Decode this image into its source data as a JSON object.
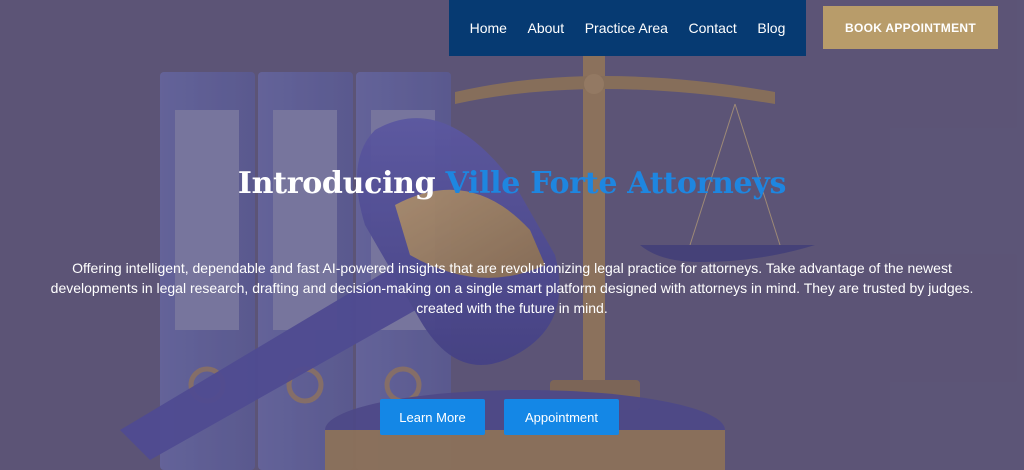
{
  "nav": {
    "items": [
      {
        "label": "Home"
      },
      {
        "label": "About"
      },
      {
        "label": "Practice Area"
      },
      {
        "label": "Contact"
      },
      {
        "label": "Blog"
      }
    ],
    "book_label": "BOOK APPOINTMENT"
  },
  "hero": {
    "title_prefix": "Introducing",
    "title_accent": "Ville Forte Attorneys",
    "description": "Offering intelligent, dependable and fast AI-powered insights that are revolutionizing legal practice for attorneys. Take advantage of the newest developments in legal research, drafting and decision-making on a single smart platform designed with attorneys in mind. They are trusted by judges. created with the future in mind.",
    "learn_more_label": "Learn More",
    "appointment_label": "Appointment"
  },
  "colors": {
    "nav_bg": "#063a72",
    "book_bg": "#b89c6a",
    "accent": "#1e86e0",
    "cta_bg": "#1487e6",
    "overlay": "#5d5777"
  },
  "icons": {
    "hero_image": "gavel-and-scales-illustration"
  }
}
